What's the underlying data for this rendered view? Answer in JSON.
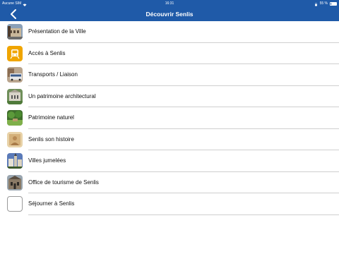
{
  "status_bar": {
    "carrier": "Aucune SIM",
    "time": "16:31",
    "battery": "55 %",
    "icons": [
      "wifi-icon",
      "lock-icon",
      "battery-icon"
    ]
  },
  "nav": {
    "title": "Découvrir Senlis",
    "back_icon": "chevron-left-icon"
  },
  "items": [
    {
      "label": "Présentation de la Ville",
      "icon": "building-thumbnail"
    },
    {
      "label": "Accès à Senlis",
      "icon": "train-icon"
    },
    {
      "label": "Transports / Liaison",
      "icon": "bus-thumbnail"
    },
    {
      "label": "Un patrimoine architectural",
      "icon": "cathedral-thumbnail"
    },
    {
      "label": "Patrimoine naturel",
      "icon": "garden-thumbnail"
    },
    {
      "label": "Senlis son histoire",
      "icon": "painting-thumbnail"
    },
    {
      "label": "Villes jumelées",
      "icon": "town-thumbnail"
    },
    {
      "label": "Office de tourisme de Senlis",
      "icon": "tourism-office-thumbnail"
    },
    {
      "label": "Séjourner à Senlis",
      "icon": "blank-thumbnail"
    }
  ],
  "colors": {
    "nav_background": "#1f5aa8",
    "accent_orange": "#f0a500",
    "separator": "#cfcfcf"
  }
}
